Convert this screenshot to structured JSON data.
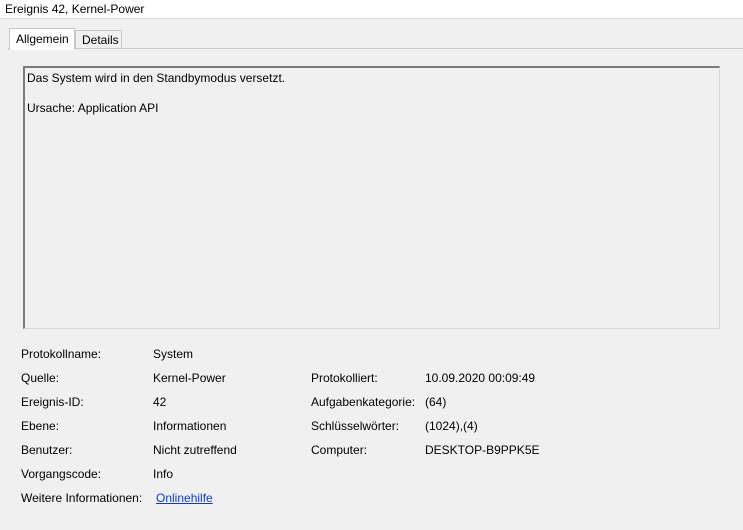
{
  "window": {
    "title": "Ereignis 42, Kernel-Power"
  },
  "tabs": [
    {
      "label": "Allgemein",
      "active": true
    },
    {
      "label": "Details",
      "active": false
    }
  ],
  "message": {
    "line1": "Das System wird in den Standbymodus versetzt.",
    "line2": "Ursache: Application API"
  },
  "properties": {
    "log_name": {
      "label": "Protokollname:",
      "value": "System"
    },
    "source": {
      "label": "Quelle:",
      "value": "Kernel-Power"
    },
    "logged": {
      "label": "Protokolliert:",
      "value": "10.09.2020 00:09:49"
    },
    "event_id": {
      "label": "Ereignis-ID:",
      "value": "42"
    },
    "task_category": {
      "label": "Aufgabenkategorie:",
      "value": "(64)"
    },
    "level": {
      "label": "Ebene:",
      "value": "Informationen"
    },
    "keywords": {
      "label": "Schlüsselwörter:",
      "value": "(1024),(4)"
    },
    "user": {
      "label": "Benutzer:",
      "value": "Nicht zutreffend"
    },
    "computer": {
      "label": "Computer:",
      "value": "DESKTOP-B9PPK5E"
    },
    "opcode": {
      "label": "Vorgangscode:",
      "value": "Info"
    },
    "more_info": {
      "label": "Weitere Informationen:",
      "link": "Onlinehilfe"
    }
  },
  "colors": {
    "link": "#0b3cc8",
    "background": "#f0f0f0",
    "title_bar": "#ffffff"
  }
}
